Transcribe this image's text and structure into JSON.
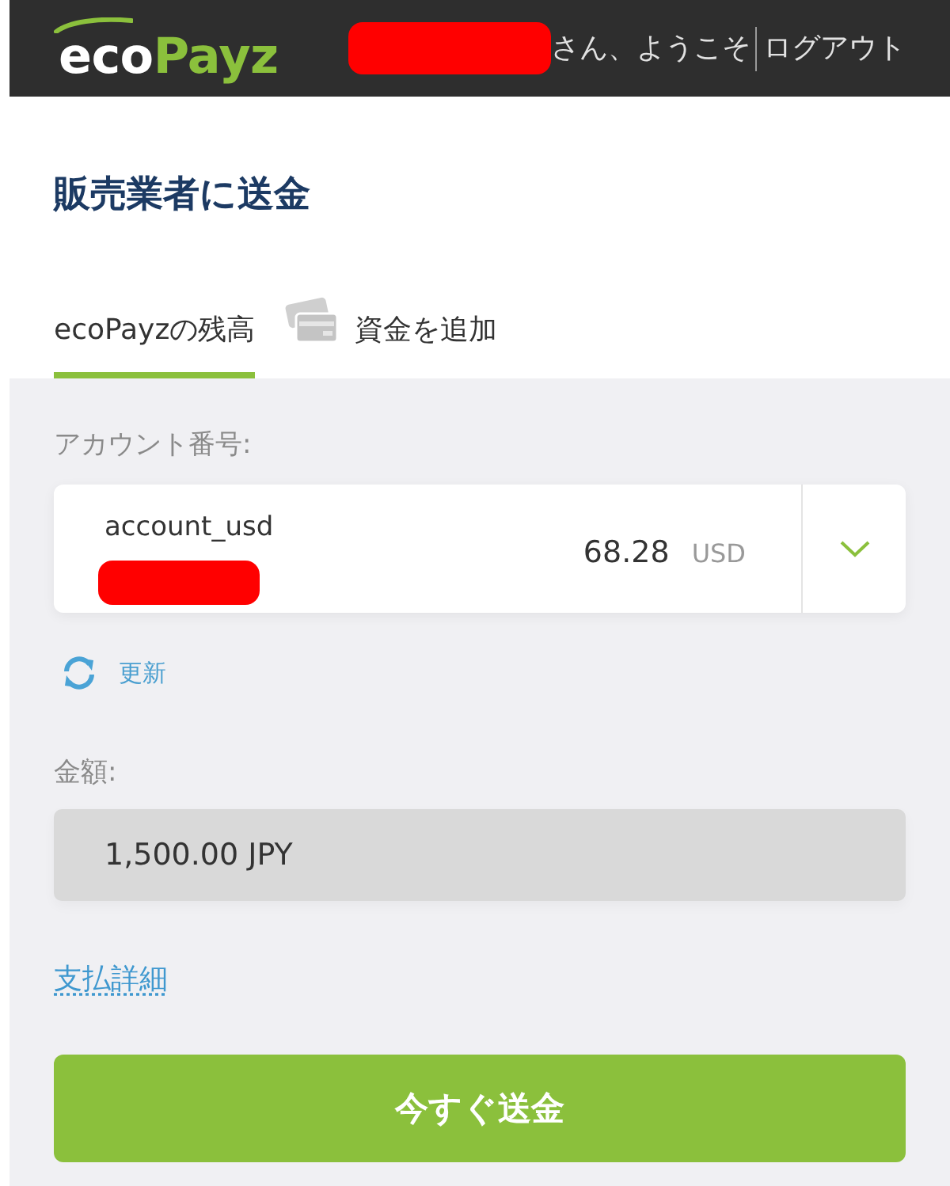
{
  "header": {
    "logo": {
      "text": "eco",
      "accent": "Payz"
    },
    "name_redacted": true,
    "greeting": "さん、ようこそ",
    "logout": "ログアウト"
  },
  "title": "販売業者に送金",
  "tabs": [
    {
      "label": "ecoPayzの残高",
      "selected": true,
      "kind": "text"
    },
    {
      "label": "資金を追加",
      "selected": false,
      "kind": "card"
    }
  ],
  "account": {
    "label": "アカウント番号:",
    "name": "account_usd",
    "number_redacted": true,
    "balance": "68.28",
    "currency": "USD"
  },
  "refresh": "更新",
  "amount": {
    "label": "金額:",
    "value": "1,500.00 JPY",
    "disabled": true
  },
  "details_link": "支払詳細",
  "submit": "今すぐ送金"
}
